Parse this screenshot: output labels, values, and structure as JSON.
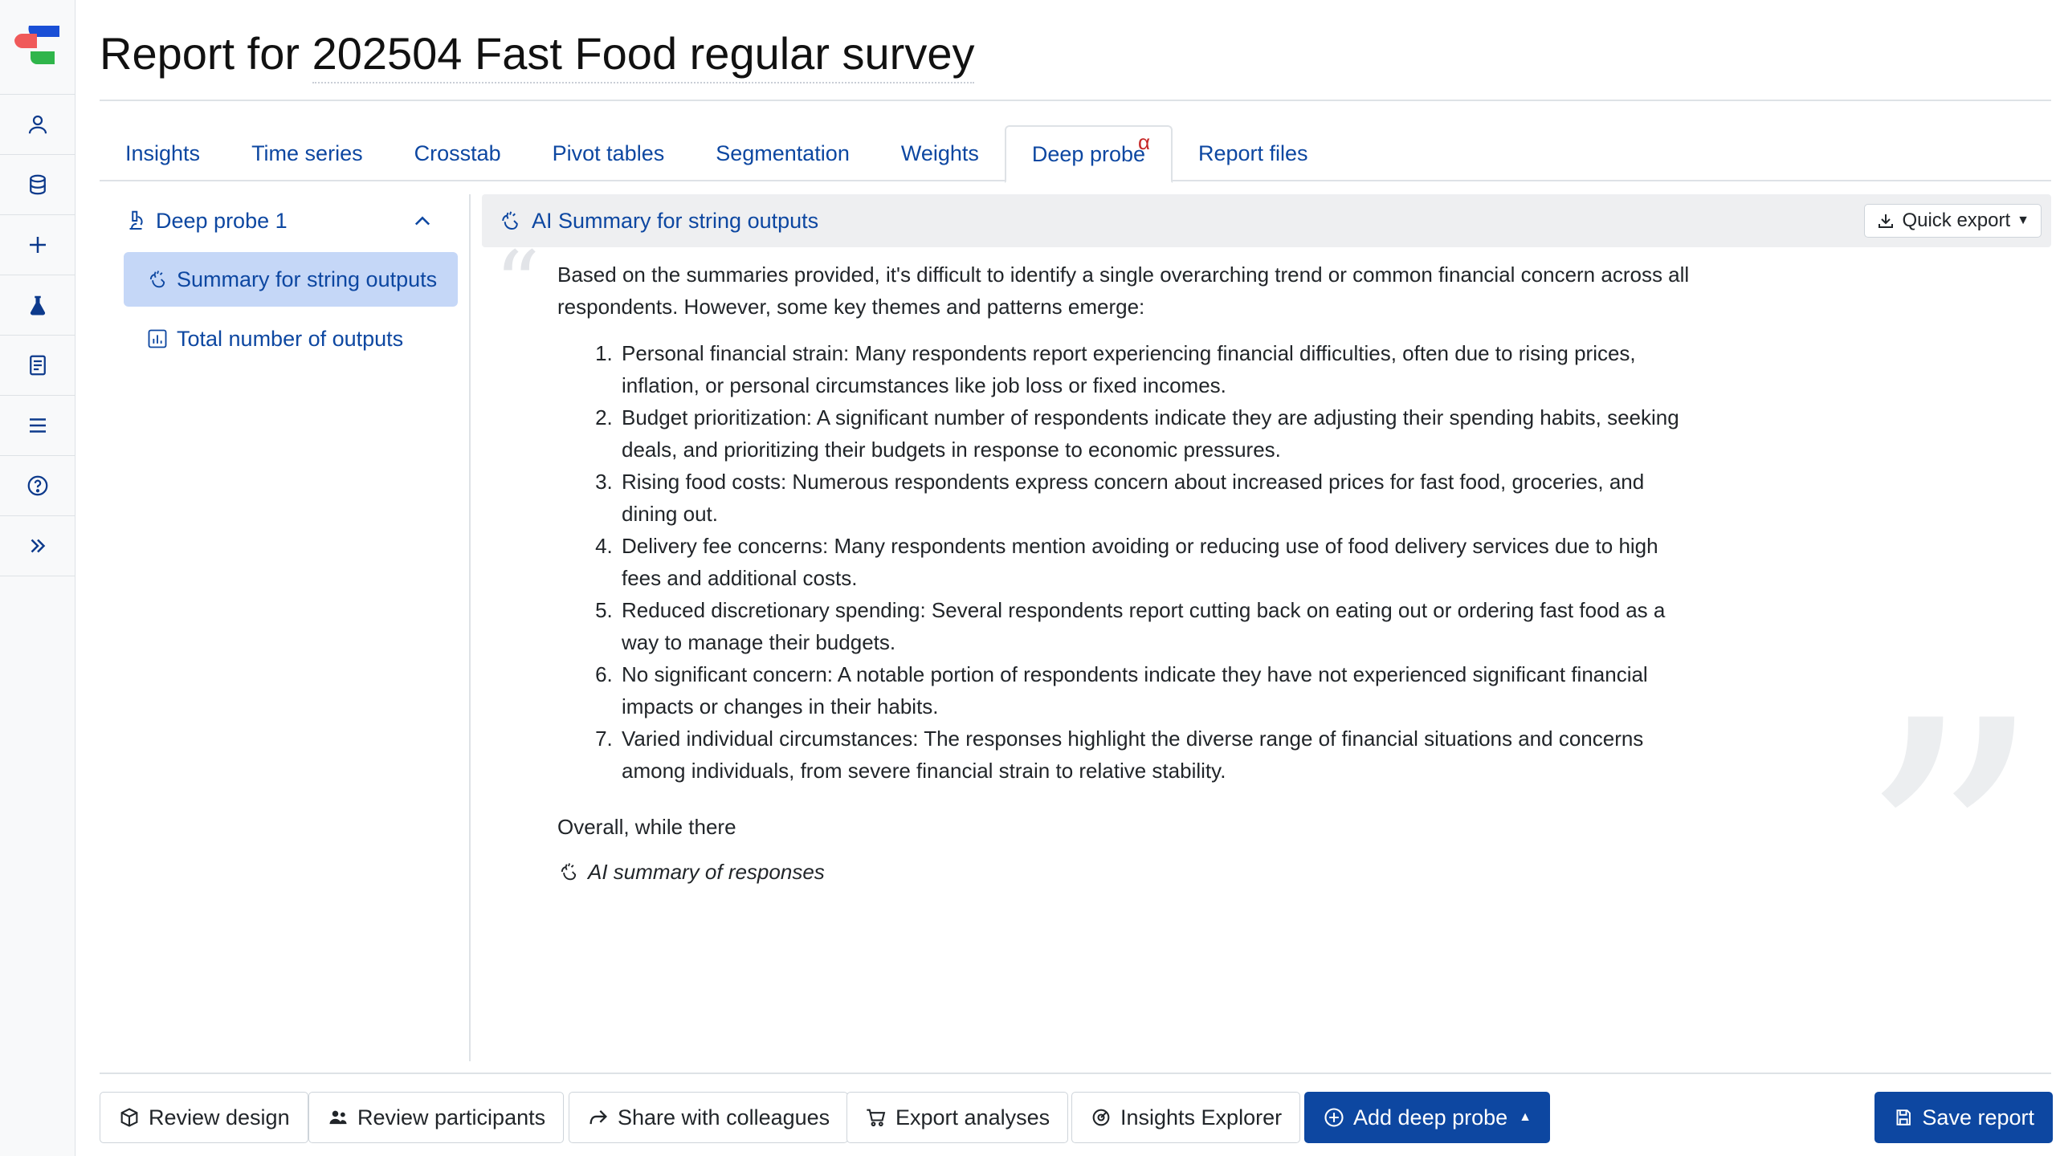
{
  "header": {
    "title_prefix": "Report for",
    "survey_name": "202504 Fast Food regular survey"
  },
  "rail": {
    "items": [
      "user-icon",
      "database-icon",
      "plus-icon",
      "flask-icon",
      "book-icon",
      "menu-icon",
      "help-icon",
      "expand-icon"
    ]
  },
  "tabs": [
    {
      "label": "Insights"
    },
    {
      "label": "Time series"
    },
    {
      "label": "Crosstab"
    },
    {
      "label": "Pivot tables"
    },
    {
      "label": "Segmentation"
    },
    {
      "label": "Weights"
    },
    {
      "label": "Deep probe",
      "badge": "α",
      "active": true
    },
    {
      "label": "Report files"
    }
  ],
  "tree": {
    "group_label": "Deep probe 1",
    "items": [
      {
        "label": "Summary for string outputs",
        "active": true
      },
      {
        "label": "Total number of outputs"
      }
    ]
  },
  "card": {
    "title": "AI Summary for string outputs",
    "quick_export": "Quick export"
  },
  "summary": {
    "intro": "Based on the summaries provided, it's difficult to identify a single overarching trend or common financial concern across all respondents. However, some key themes and patterns emerge:",
    "points": [
      "Personal financial strain: Many respondents report experiencing financial difficulties, often due to rising prices, inflation, or personal circumstances like job loss or fixed incomes.",
      "Budget prioritization: A significant number of respondents indicate they are adjusting their spending habits, seeking deals, and prioritizing their budgets in response to economic pressures.",
      "Rising food costs: Numerous respondents express concern about increased prices for fast food, groceries, and dining out.",
      "Delivery fee concerns: Many respondents mention avoiding or reducing use of food delivery services due to high fees and additional costs.",
      "Reduced discretionary spending: Several respondents report cutting back on eating out or ordering fast food as a way to manage their budgets.",
      "No significant concern: A notable portion of respondents indicate they have not experienced significant financial impacts or changes in their habits.",
      "Varied individual circumstances: The responses highlight the diverse range of financial situations and concerns among individuals, from severe financial strain to relative stability."
    ],
    "overall": "Overall, while there",
    "signature": "AI summary of responses"
  },
  "footer": {
    "review_design": "Review design",
    "review_participants": "Review participants",
    "share": "Share with colleagues",
    "export": "Export analyses",
    "insights_explorer": "Insights Explorer",
    "add_deep_probe": "Add deep probe",
    "save_report": "Save report"
  },
  "colors": {
    "primary": "#0d47a1",
    "active_tree_bg": "#c5d7f7",
    "alpha_badge": "#c62828"
  }
}
